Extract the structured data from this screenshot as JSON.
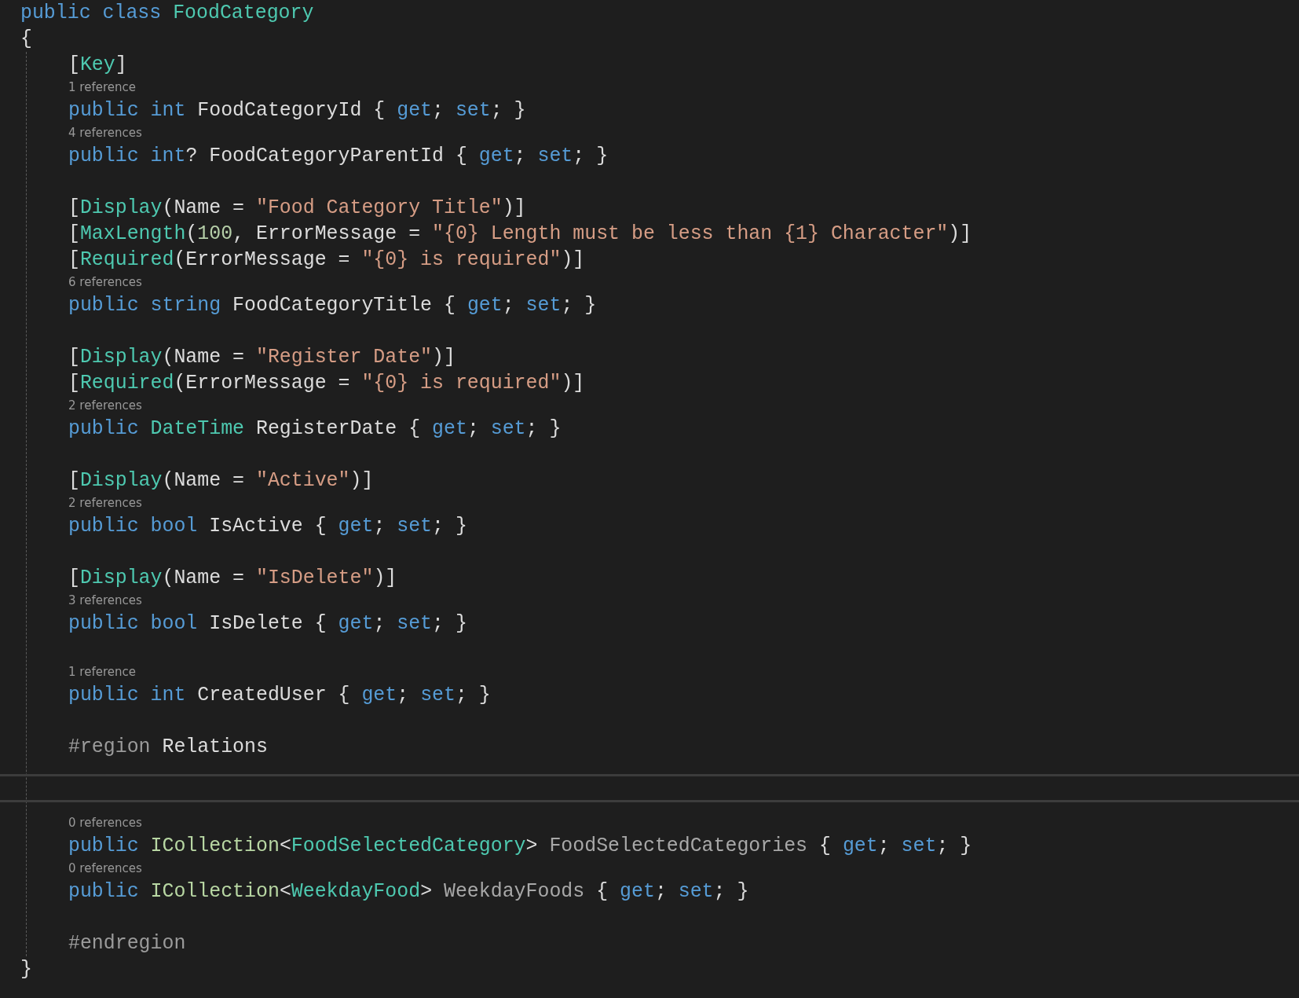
{
  "lines": [
    {
      "kind": "code",
      "tokens": [
        {
          "text": "public class ",
          "kind": "keyword"
        },
        {
          "text": "FoodCategory",
          "kind": "type"
        }
      ]
    },
    {
      "kind": "code",
      "tokens": [
        {
          "text": "{",
          "kind": "plain"
        }
      ]
    },
    {
      "kind": "block",
      "children": [
        {
          "kind": "code",
          "tokens": [
            {
              "text": "[",
              "kind": "plain"
            },
            {
              "text": "Key",
              "kind": "type"
            },
            {
              "text": "]",
              "kind": "plain"
            }
          ]
        },
        {
          "kind": "lens",
          "text": "1 reference"
        },
        {
          "kind": "code",
          "tokens": [
            {
              "text": "public int",
              "kind": "keyword"
            },
            {
              "text": " FoodCategoryId { ",
              "kind": "plain"
            },
            {
              "text": "get",
              "kind": "keyword"
            },
            {
              "text": "; ",
              "kind": "plain"
            },
            {
              "text": "set",
              "kind": "keyword"
            },
            {
              "text": "; }",
              "kind": "plain"
            }
          ]
        },
        {
          "kind": "lens",
          "text": "4 references"
        },
        {
          "kind": "code",
          "tokens": [
            {
              "text": "public int",
              "kind": "keyword"
            },
            {
              "text": "? FoodCategoryParentId { ",
              "kind": "plain"
            },
            {
              "text": "get",
              "kind": "keyword"
            },
            {
              "text": "; ",
              "kind": "plain"
            },
            {
              "text": "set",
              "kind": "keyword"
            },
            {
              "text": "; }",
              "kind": "plain"
            }
          ]
        },
        {
          "kind": "blank"
        },
        {
          "kind": "code",
          "tokens": [
            {
              "text": "[",
              "kind": "plain"
            },
            {
              "text": "Display",
              "kind": "type"
            },
            {
              "text": "(Name = ",
              "kind": "plain"
            },
            {
              "text": "\"Food Category Title\"",
              "kind": "string"
            },
            {
              "text": ")]",
              "kind": "plain"
            }
          ]
        },
        {
          "kind": "code",
          "tokens": [
            {
              "text": "[",
              "kind": "plain"
            },
            {
              "text": "MaxLength",
              "kind": "type"
            },
            {
              "text": "(",
              "kind": "plain"
            },
            {
              "text": "100",
              "kind": "number"
            },
            {
              "text": ", ErrorMessage = ",
              "kind": "plain"
            },
            {
              "text": "\"{0} Length must be less than {1} Character\"",
              "kind": "string"
            },
            {
              "text": ")]",
              "kind": "plain"
            }
          ]
        },
        {
          "kind": "code",
          "tokens": [
            {
              "text": "[",
              "kind": "plain"
            },
            {
              "text": "Required",
              "kind": "type"
            },
            {
              "text": "(ErrorMessage = ",
              "kind": "plain"
            },
            {
              "text": "\"{0} is required\"",
              "kind": "string"
            },
            {
              "text": ")]",
              "kind": "plain"
            }
          ]
        },
        {
          "kind": "lens",
          "text": "6 references"
        },
        {
          "kind": "code",
          "tokens": [
            {
              "text": "public string",
              "kind": "keyword"
            },
            {
              "text": " FoodCategoryTitle { ",
              "kind": "plain"
            },
            {
              "text": "get",
              "kind": "keyword"
            },
            {
              "text": "; ",
              "kind": "plain"
            },
            {
              "text": "set",
              "kind": "keyword"
            },
            {
              "text": "; }",
              "kind": "plain"
            }
          ]
        },
        {
          "kind": "blank"
        },
        {
          "kind": "code",
          "tokens": [
            {
              "text": "[",
              "kind": "plain"
            },
            {
              "text": "Display",
              "kind": "type"
            },
            {
              "text": "(Name = ",
              "kind": "plain"
            },
            {
              "text": "\"Register Date\"",
              "kind": "string"
            },
            {
              "text": ")]",
              "kind": "plain"
            }
          ]
        },
        {
          "kind": "code",
          "tokens": [
            {
              "text": "[",
              "kind": "plain"
            },
            {
              "text": "Required",
              "kind": "type"
            },
            {
              "text": "(ErrorMessage = ",
              "kind": "plain"
            },
            {
              "text": "\"{0} is required\"",
              "kind": "string"
            },
            {
              "text": ")]",
              "kind": "plain"
            }
          ]
        },
        {
          "kind": "lens",
          "text": "2 references"
        },
        {
          "kind": "code",
          "tokens": [
            {
              "text": "public ",
              "kind": "keyword"
            },
            {
              "text": "DateTime",
              "kind": "type"
            },
            {
              "text": " RegisterDate { ",
              "kind": "plain"
            },
            {
              "text": "get",
              "kind": "keyword"
            },
            {
              "text": "; ",
              "kind": "plain"
            },
            {
              "text": "set",
              "kind": "keyword"
            },
            {
              "text": "; }",
              "kind": "plain"
            }
          ]
        },
        {
          "kind": "blank"
        },
        {
          "kind": "code",
          "tokens": [
            {
              "text": "[",
              "kind": "plain"
            },
            {
              "text": "Display",
              "kind": "type"
            },
            {
              "text": "(Name = ",
              "kind": "plain"
            },
            {
              "text": "\"Active\"",
              "kind": "string"
            },
            {
              "text": ")]",
              "kind": "plain"
            }
          ]
        },
        {
          "kind": "lens",
          "text": "2 references"
        },
        {
          "kind": "code",
          "tokens": [
            {
              "text": "public bool",
              "kind": "keyword"
            },
            {
              "text": " IsActive { ",
              "kind": "plain"
            },
            {
              "text": "get",
              "kind": "keyword"
            },
            {
              "text": "; ",
              "kind": "plain"
            },
            {
              "text": "set",
              "kind": "keyword"
            },
            {
              "text": "; }",
              "kind": "plain"
            }
          ]
        },
        {
          "kind": "blank"
        },
        {
          "kind": "code",
          "tokens": [
            {
              "text": "[",
              "kind": "plain"
            },
            {
              "text": "Display",
              "kind": "type"
            },
            {
              "text": "(Name = ",
              "kind": "plain"
            },
            {
              "text": "\"IsDelete\"",
              "kind": "string"
            },
            {
              "text": ")]",
              "kind": "plain"
            }
          ]
        },
        {
          "kind": "lens",
          "text": "3 references"
        },
        {
          "kind": "code",
          "tokens": [
            {
              "text": "public bool",
              "kind": "keyword"
            },
            {
              "text": " IsDelete { ",
              "kind": "plain"
            },
            {
              "text": "get",
              "kind": "keyword"
            },
            {
              "text": "; ",
              "kind": "plain"
            },
            {
              "text": "set",
              "kind": "keyword"
            },
            {
              "text": "; }",
              "kind": "plain"
            }
          ]
        },
        {
          "kind": "blank"
        },
        {
          "kind": "lens",
          "text": "1 reference"
        },
        {
          "kind": "code",
          "tokens": [
            {
              "text": "public int",
              "kind": "keyword"
            },
            {
              "text": " CreatedUser { ",
              "kind": "plain"
            },
            {
              "text": "get",
              "kind": "keyword"
            },
            {
              "text": "; ",
              "kind": "plain"
            },
            {
              "text": "set",
              "kind": "keyword"
            },
            {
              "text": "; }",
              "kind": "plain"
            }
          ]
        },
        {
          "kind": "blank"
        },
        {
          "kind": "code",
          "tokens": [
            {
              "text": "#region",
              "kind": "directive"
            },
            {
              "text": " Relations",
              "kind": "plain"
            }
          ]
        },
        {
          "kind": "blank"
        },
        {
          "kind": "splitter"
        },
        {
          "kind": "lens",
          "text": "0 references"
        },
        {
          "kind": "code",
          "tokens": [
            {
              "text": "public ",
              "kind": "keyword"
            },
            {
              "text": "ICollection",
              "kind": "interface"
            },
            {
              "text": "<",
              "kind": "plain"
            },
            {
              "text": "FoodSelectedCategory",
              "kind": "type"
            },
            {
              "text": "> ",
              "kind": "plain"
            },
            {
              "text": "FoodSelectedCategories",
              "kind": "unused"
            },
            {
              "text": " { ",
              "kind": "plain"
            },
            {
              "text": "get",
              "kind": "keyword"
            },
            {
              "text": "; ",
              "kind": "plain"
            },
            {
              "text": "set",
              "kind": "keyword"
            },
            {
              "text": "; }",
              "kind": "plain"
            }
          ]
        },
        {
          "kind": "lens",
          "text": "0 references"
        },
        {
          "kind": "code",
          "tokens": [
            {
              "text": "public ",
              "kind": "keyword"
            },
            {
              "text": "ICollection",
              "kind": "interface"
            },
            {
              "text": "<",
              "kind": "plain"
            },
            {
              "text": "WeekdayFood",
              "kind": "type"
            },
            {
              "text": "> ",
              "kind": "plain"
            },
            {
              "text": "WeekdayFoods",
              "kind": "unused"
            },
            {
              "text": " { ",
              "kind": "plain"
            },
            {
              "text": "get",
              "kind": "keyword"
            },
            {
              "text": "; ",
              "kind": "plain"
            },
            {
              "text": "set",
              "kind": "keyword"
            },
            {
              "text": "; }",
              "kind": "plain"
            }
          ]
        },
        {
          "kind": "blank"
        },
        {
          "kind": "code",
          "tokens": [
            {
              "text": "#endregion",
              "kind": "directive"
            }
          ]
        }
      ]
    },
    {
      "kind": "code",
      "tokens": [
        {
          "text": "}",
          "kind": "plain"
        }
      ]
    }
  ]
}
